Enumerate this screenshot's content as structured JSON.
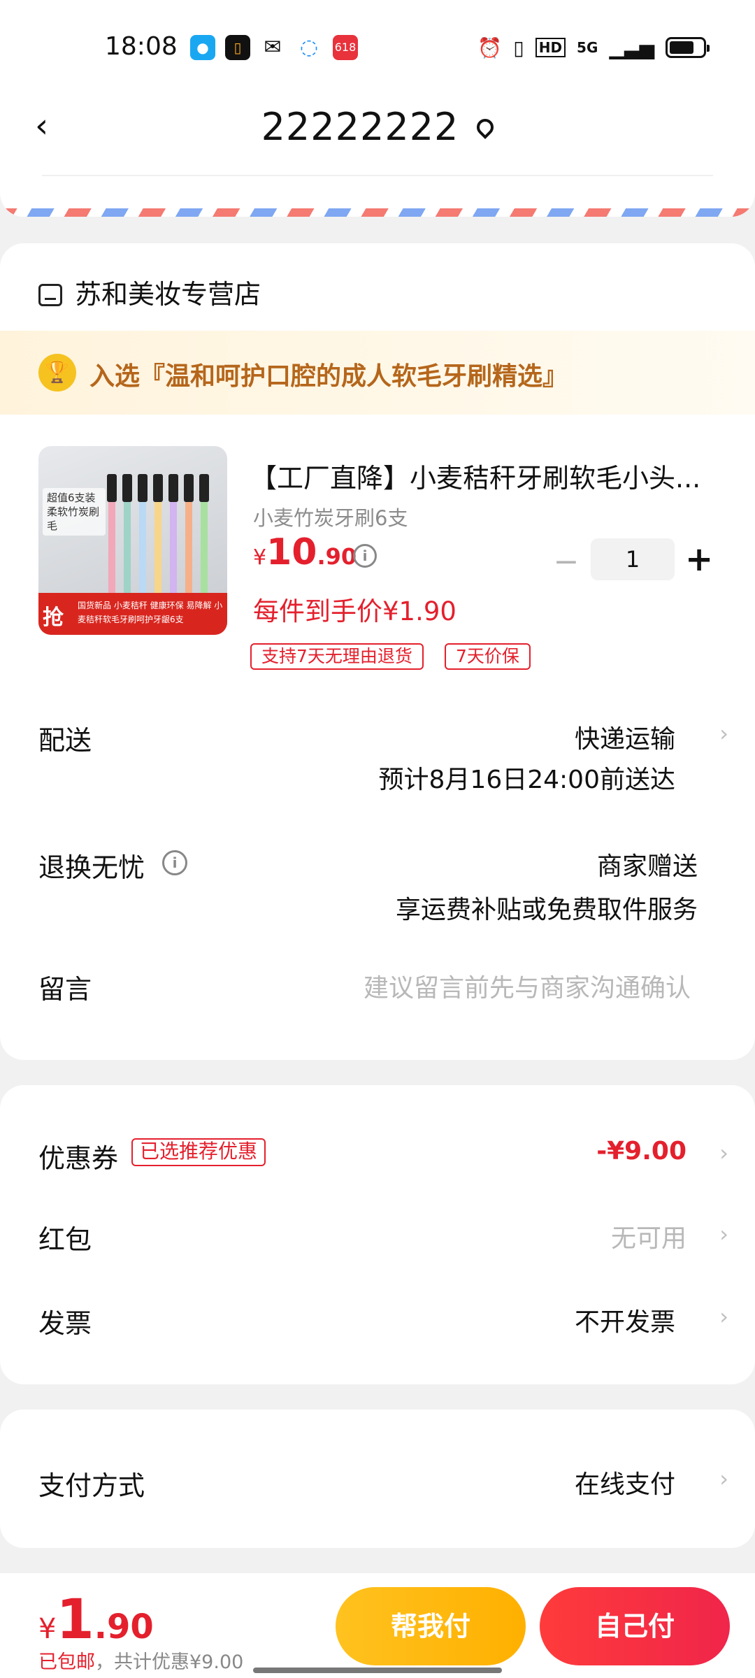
{
  "status_bar": {
    "time": "18:08",
    "app_icons": [
      "qq-icon",
      "app-icon",
      "wechat-icon",
      "browser-icon",
      "618-icon"
    ],
    "app_618_label": "618",
    "network": "5G"
  },
  "header": {
    "back_icon": "chevron-left-icon",
    "address": "22222222",
    "location_icon": "location-pin-icon"
  },
  "shop": {
    "name": "苏和美妆专营店",
    "banner": "入选『温和呵护口腔的成人软毛牙刷精选』"
  },
  "product": {
    "title": "【工厂直降】小麦秸秆牙刷软毛小头...",
    "spec": "小麦竹炭牙刷6支",
    "price_symbol": "¥",
    "price_int": "10",
    "price_dec": ".90",
    "unit_price": "每件到手价¥1.90",
    "quantity": "1",
    "tags": [
      "支持7天无理由退货",
      "7天价保"
    ],
    "image_texts": {
      "badge": "超值6支装 柔软竹炭刷毛",
      "qiang": "抢",
      "bottom": "国货新品 小麦秸秆 健康环保 易降解 小麦秸秆软毛牙刷呵护牙龈6支"
    }
  },
  "delivery": {
    "label": "配送",
    "method": "快递运输",
    "eta": "预计8月16日24:00前送达"
  },
  "returns": {
    "label": "退换无忧",
    "value": "商家赠送",
    "desc": "享运费补贴或免费取件服务"
  },
  "message": {
    "label": "留言",
    "placeholder": "建议留言前先与商家沟通确认"
  },
  "discounts": {
    "coupon_label": "优惠券",
    "coupon_tag": "已选推荐优惠",
    "coupon_value": "-¥9.00",
    "redpacket_label": "红包",
    "redpacket_value": "无可用",
    "invoice_label": "发票",
    "invoice_value": "不开发票"
  },
  "payment": {
    "label": "支付方式",
    "value": "在线支付"
  },
  "bottom_bar": {
    "total_symbol": "¥",
    "total_int": "1",
    "total_dec": ".90",
    "shipping_note": "已包邮",
    "discount_note": "，共计优惠¥9.00",
    "help_pay": "帮我付",
    "self_pay": "自己付"
  },
  "colors": {
    "accent_red": "#e4202d",
    "accent_yellow": "#ffb000",
    "banner_text": "#b5661b"
  }
}
